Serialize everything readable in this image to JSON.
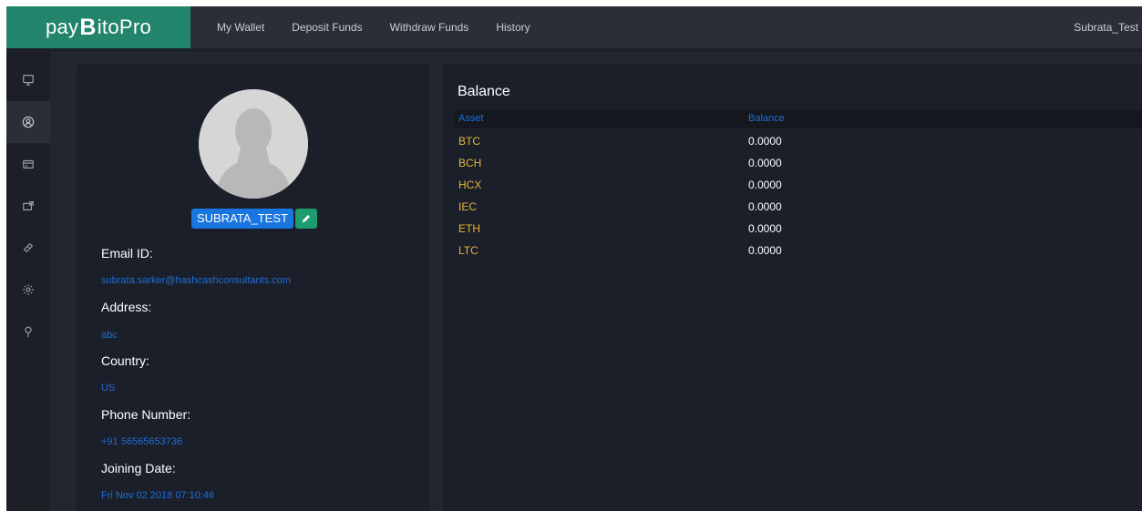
{
  "brand": {
    "prefix": "pay",
    "symbol": "B",
    "suffix": "itoPro"
  },
  "nav": [
    "My Wallet",
    "Deposit Funds",
    "Withdraw Funds",
    "History"
  ],
  "user": {
    "name": "Subrata_Test"
  },
  "sidebar": {
    "icons": [
      "monitor-icon",
      "user-circle-icon",
      "card-icon",
      "wallet-send-icon",
      "ticket-icon",
      "gear-icon",
      "pin-icon"
    ],
    "active_index": 1
  },
  "profile": {
    "username": "SUBRATA_TEST",
    "fields": [
      {
        "label": "Email ID:",
        "value": "subrata.sarker@hashcashconsultants.com"
      },
      {
        "label": "Address:",
        "value": "abc"
      },
      {
        "label": "Country:",
        "value": "US"
      },
      {
        "label": "Phone Number:",
        "value": "+91 56565653736"
      },
      {
        "label": "Joining Date:",
        "value": "Fri Nov 02 2018 07:10:46"
      }
    ]
  },
  "balance": {
    "title": "Balance",
    "headers": {
      "asset": "Asset",
      "balance": "Balance"
    },
    "rows": [
      {
        "asset": "BTC",
        "balance": "0.0000"
      },
      {
        "asset": "BCH",
        "balance": "0.0000"
      },
      {
        "asset": "HCX",
        "balance": "0.0000"
      },
      {
        "asset": "IEC",
        "balance": "0.0000"
      },
      {
        "asset": "ETH",
        "balance": "0.0000"
      },
      {
        "asset": "LTC",
        "balance": "0.0000"
      }
    ]
  },
  "colors": {
    "brand_green": "#23846c",
    "link_blue": "#1e6ed8",
    "asset_gold": "#e6b63a",
    "badge_blue": "#1975e0",
    "edit_green": "#1e9c6e"
  }
}
